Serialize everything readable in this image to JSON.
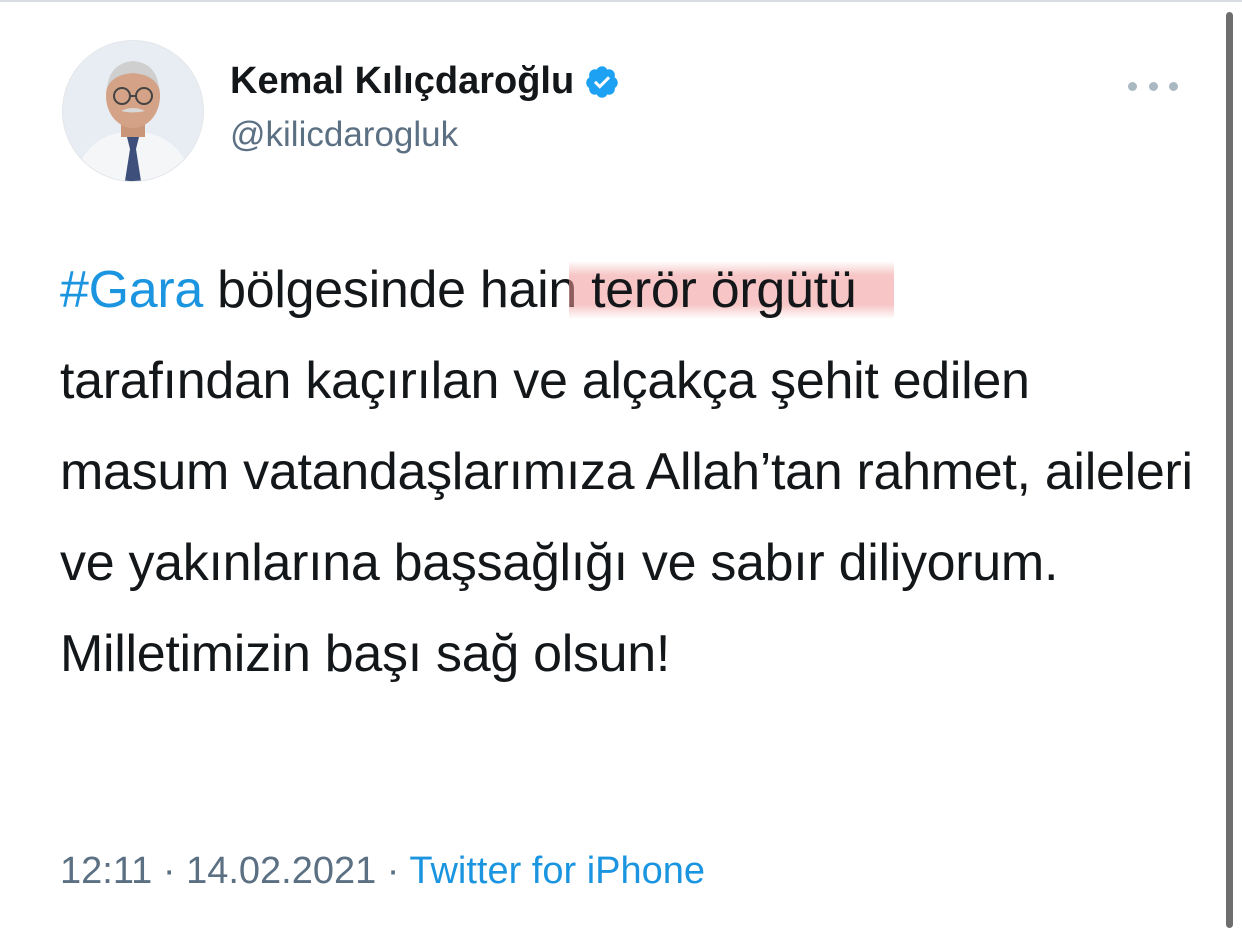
{
  "author": {
    "name": "Kemal Kılıçdaroğlu",
    "handle": "@kilicdarogluk",
    "verified": true,
    "avatar_icon": "profile-photo-avatar"
  },
  "tweet": {
    "hashtag": "#Gara",
    "text_part1": " bölgesinde hain",
    "highlighted": " terör örgütü",
    "text_part2": "tarafından kaçırılan ve alçakça şehit edilen masum vatandaşlarımıza Allah’tan rahmet, aileleri ve yakınlarına başsağlığı ve sabır diliyorum. Milletimizin başı sağ olsun!"
  },
  "meta": {
    "time": "12:11",
    "separator": " · ",
    "date": "14.02.2021",
    "source": "Twitter for iPhone"
  },
  "colors": {
    "link": "#1b95e0",
    "text": "#14171a",
    "secondary": "#5b7083",
    "highlight": "#f09696"
  },
  "icons": {
    "verified": "verified-badge-icon",
    "more": "more-options-icon"
  }
}
